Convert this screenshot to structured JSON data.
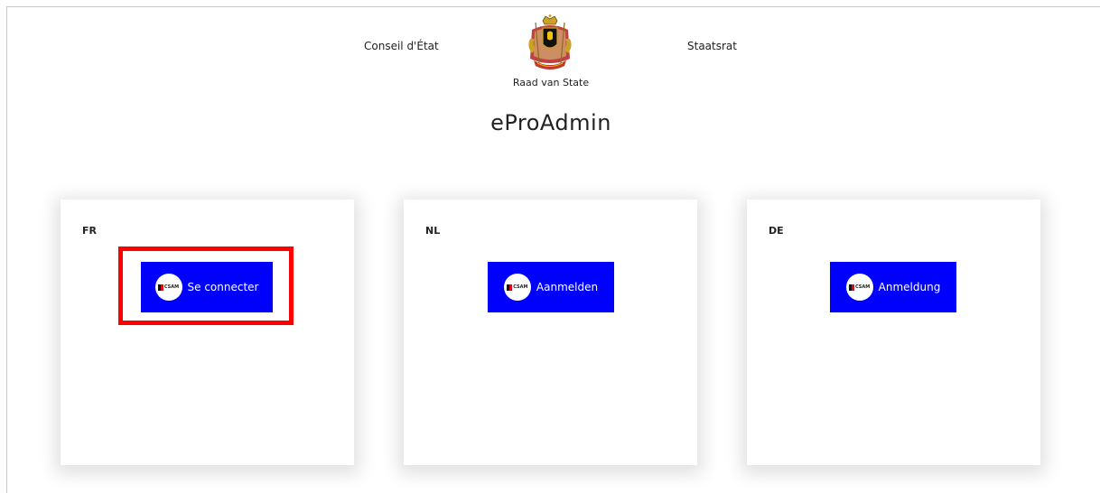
{
  "header": {
    "left_label": "Conseil d'État",
    "right_label": "Staatsrat",
    "center_label": "Raad van State",
    "crest_icon": "belgian-coat-of-arms-icon"
  },
  "app_title": "eProAdmin",
  "cards": [
    {
      "lang": "FR",
      "button_label": "Se connecter",
      "badge_text": "CSAM"
    },
    {
      "lang": "NL",
      "button_label": "Aanmelden",
      "badge_text": "CSAM"
    },
    {
      "lang": "DE",
      "button_label": "Anmeldung",
      "badge_text": "CSAM"
    }
  ],
  "colors": {
    "button_bg": "#0000ff",
    "highlight": "#ff0000"
  }
}
